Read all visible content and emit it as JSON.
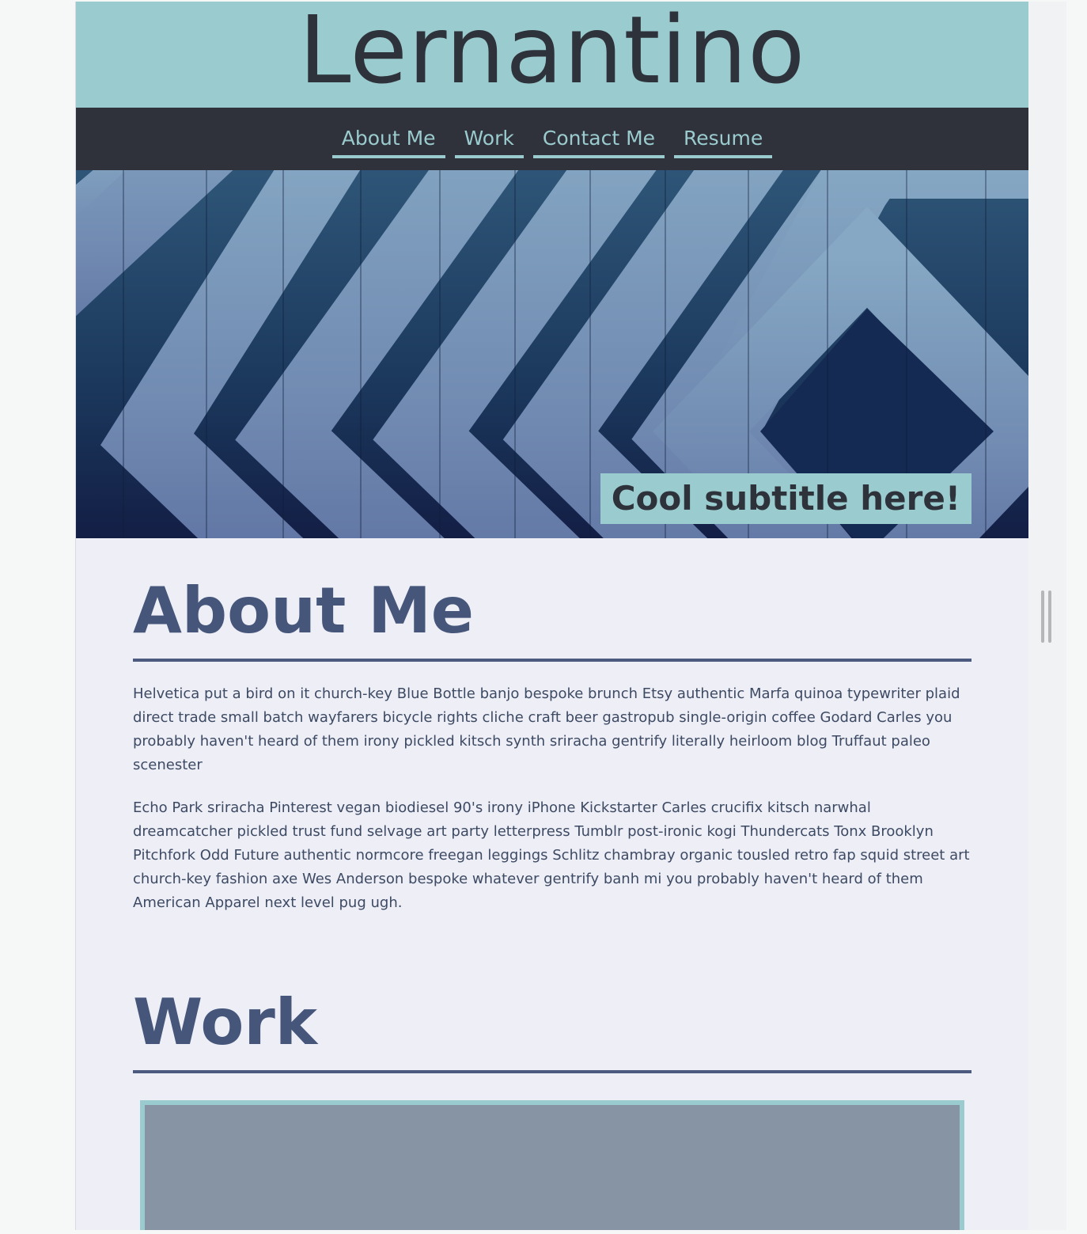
{
  "site": {
    "title": "Lernantino"
  },
  "nav": {
    "items": [
      {
        "label": "About Me"
      },
      {
        "label": "Work"
      },
      {
        "label": "Contact Me"
      },
      {
        "label": "Resume"
      }
    ]
  },
  "hero": {
    "subtitle": "Cool subtitle here!"
  },
  "about": {
    "title": "About Me",
    "paragraphs": [
      "Helvetica put a bird on it church-key Blue Bottle banjo bespoke brunch Etsy authentic Marfa quinoa typewriter plaid direct trade small batch wayfarers bicycle rights cliche craft beer gastropub single-origin coffee Godard Carles you probably haven't heard of them irony pickled kitsch synth sriracha gentrify literally heirloom blog Truffaut paleo scenester",
      "Echo Park sriracha Pinterest vegan biodiesel 90's irony iPhone Kickstarter Carles crucifix kitsch narwhal dreamcatcher pickled trust fund selvage art party letterpress Tumblr post-ironic kogi Thundercats Tonx Brooklyn Pitchfork Odd Future authentic normcore freegan leggings Schlitz chambray organic tousled retro fap squid street art church-key fashion axe Wes Anderson bespoke whatever gentrify banh mi you probably haven't heard of them American Apparel next level pug ugh."
    ]
  },
  "work": {
    "title": "Work"
  },
  "colors": {
    "accent": "#9acbce",
    "dark": "#2f323b",
    "heading": "#45567a",
    "background": "#eeeef6",
    "card": "#8694a3"
  }
}
